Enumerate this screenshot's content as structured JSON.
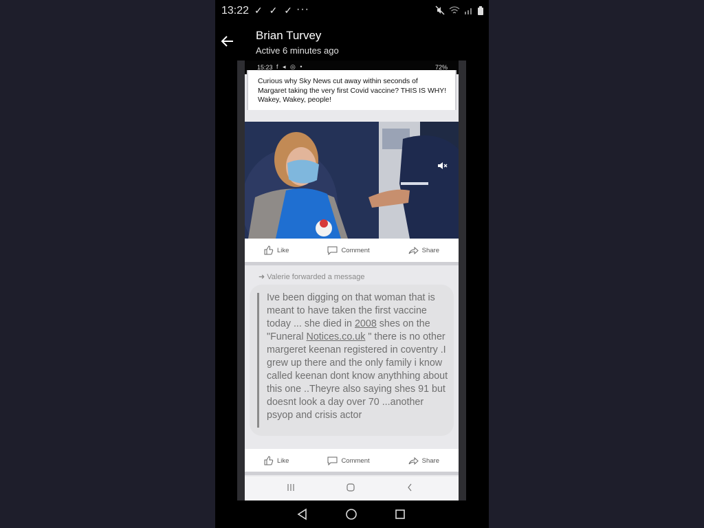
{
  "status_bar": {
    "time": "13:22",
    "notification_ticks": "✓ ✓ ✓",
    "more": "···"
  },
  "header": {
    "contact_name": "Brian Turvey",
    "contact_status": "Active 6 minutes ago"
  },
  "shared_screenshot": {
    "status_time": "15:23",
    "status_icons": "f ◂ ◎ •",
    "battery": "72%",
    "post_text": "Curious why Sky News cut away within seconds of Margaret taking the very first Covid vaccine? THIS IS WHY! Wakey, Wakey, people!",
    "actions": {
      "like": "Like",
      "comment": "Comment",
      "share": "Share"
    },
    "forward_label": "Valerie forwarded a message",
    "forwarded_message": {
      "part1": "Ive been digging on that woman that is meant to have taken the first vaccine today ... she died in ",
      "link_year": "2008",
      "part2": " shes on the \"Funeral ",
      "link_site": "Notices.co.uk",
      "part3": " \" there is no other margeret keenan registered in coventry .I grew up there and the only family i know called keenan dont know anythhing about this one ..Theyre also saying shes 91 but doesnt look a day over 70 ...another psyop and crisis actor"
    }
  },
  "colors": {
    "page_background": "#1e1e2b",
    "phone_background": "#000000",
    "bubble": "#e2e2e4"
  },
  "icons": {
    "back": "arrow-left-icon",
    "like": "thumbs-up-icon",
    "comment": "speech-bubble-icon",
    "share": "share-arrow-icon",
    "mute": "speaker-muted-icon"
  }
}
